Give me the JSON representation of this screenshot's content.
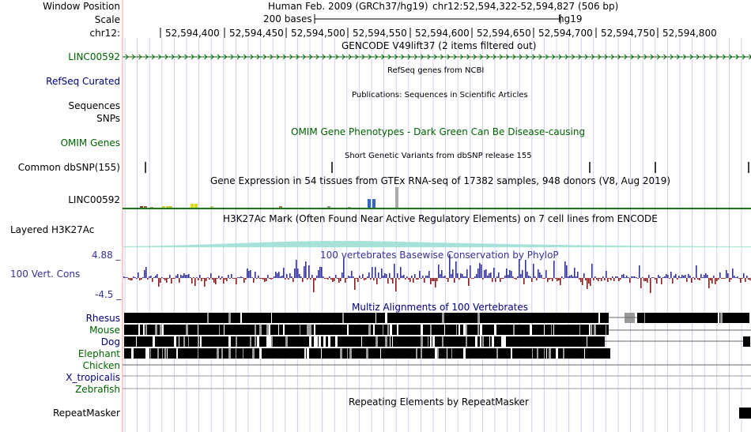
{
  "header": {
    "window_position_label": "Window Position",
    "assembly": "Human Feb. 2009 (GRCh37/hg19)",
    "coords": "chr12:52,594,322-52,594,827 (506 bp)",
    "scale_label": "Scale",
    "scale_text": "200 bases",
    "scale_db": "hg19",
    "chrom_label": "chr12:",
    "ticks": [
      "52,594,400",
      "52,594,450",
      "52,594,500",
      "52,594,550",
      "52,594,600",
      "52,594,650",
      "52,594,700",
      "52,594,750",
      "52,594,800"
    ]
  },
  "tracks": {
    "gencode_title": "GENCODE V49lift37 (2 items filtered out)",
    "gencode_item": "LINC00592",
    "refseq_label": "RefSeq Curated",
    "refseq_title": "RefSeq genes from NCBI",
    "pubs_label": "Sequences",
    "pubs_title": "Publications: Sequences in Scientific Articles",
    "snps_label": "SNPs",
    "omim_title": "OMIM Gene Phenotypes - Dark Green Can Be Disease-causing",
    "omim_label": "OMIM Genes",
    "dbsnp_title": "Short Genetic Variants from dbSNP release 155",
    "dbsnp_label": "Common dbSNP(155)",
    "gtex_title": "Gene Expression in 54 tissues from GTEx RNA-seq of 17382 samples, 948 donors (V8, Aug 2019)",
    "gtex_label": "LINC00592",
    "h3k27ac_title": "H3K27Ac Mark (Often Found Near Active Regulatory Elements) on 7 cell lines from ENCODE",
    "h3k27ac_label": "Layered H3K27Ac",
    "cons_title": "100 vertebrates Basewise Conservation by PhyloP",
    "cons_label": "100 Vert. Cons",
    "cons_max": "4.88 _",
    "cons_min": "-4.5 _",
    "multiz_title": "Multiz Alignments of 100 Vertebrates",
    "species": [
      {
        "name": "Rhesus"
      },
      {
        "name": "Mouse"
      },
      {
        "name": "Dog"
      },
      {
        "name": "Elephant"
      },
      {
        "name": "Chicken"
      },
      {
        "name": "X_tropicalis"
      },
      {
        "name": "Zebrafish"
      }
    ],
    "rmsk_title": "Repeating Elements by RepeatMasker",
    "rmsk_label": "RepeatMasker"
  },
  "colors": {
    "gencode": "#006400",
    "refseq": "#0c0c78",
    "omim": "#006400",
    "cons_pos": "#333399",
    "cons_neg": "#8b1a1a",
    "grid": "#d0d0f0",
    "left_border": "#ff9999"
  }
}
